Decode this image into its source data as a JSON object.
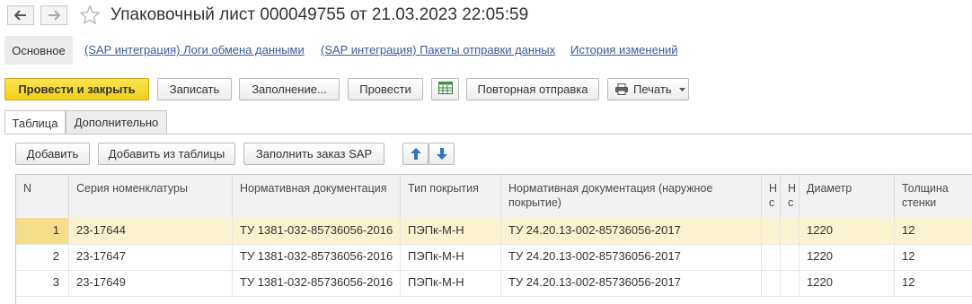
{
  "window": {
    "title": "Упаковочный лист 000049755 от 21.03.2023 22:05:59",
    "icons": [
      "arrow-left-icon",
      "arrow-right-icon",
      "star-icon"
    ]
  },
  "sections": {
    "main": "Основное",
    "links": [
      "(SAP интеграция) Логи обмена данными",
      "(SAP интеграция) Пакеты отправки данных",
      "История изменений"
    ]
  },
  "toolbar": {
    "post_and_close": "Провести и закрыть",
    "save": "Записать",
    "fill": "Заполнение...",
    "post": "Провести",
    "resend": "Повторная отправка",
    "print": "Печать",
    "icons": [
      "spreadsheet-icon",
      "printer-icon",
      "dropdown-caret-icon"
    ]
  },
  "tabs": {
    "table": "Таблица",
    "additional": "Дополнительно"
  },
  "table_toolbar": {
    "add": "Добавить",
    "add_from_table": "Добавить из таблицы",
    "fill_sap_order": "Заполнить заказ SAP",
    "icons": [
      "move-up-icon",
      "move-down-icon"
    ]
  },
  "table": {
    "columns": [
      {
        "key": "n",
        "label": "N"
      },
      {
        "key": "series",
        "label": "Серия номенклатуры"
      },
      {
        "key": "norm_doc",
        "label": "Нормативная документация"
      },
      {
        "key": "coating",
        "label": "Тип покрытия"
      },
      {
        "key": "norm_doc_outer",
        "label": "Нормативная документация (наружное покрытие)"
      },
      {
        "key": "h1",
        "label": "Н с"
      },
      {
        "key": "h2",
        "label": "Н с"
      },
      {
        "key": "diameter",
        "label": "Диаметр"
      },
      {
        "key": "wall",
        "label": "Толщина стенки"
      }
    ],
    "rows": [
      {
        "n": "1",
        "series": "23-17644",
        "norm_doc": "ТУ 1381-032-85736056-2016",
        "coating": "ПЭПк-М-Н",
        "norm_doc_outer": "ТУ 24.20.13-002-85736056-2017",
        "h1": "",
        "h2": "",
        "diameter": "1220",
        "wall": "12"
      },
      {
        "n": "2",
        "series": "23-17647",
        "norm_doc": "ТУ 1381-032-85736056-2016",
        "coating": "ПЭПк-М-Н",
        "norm_doc_outer": "ТУ 24.20.13-002-85736056-2017",
        "h1": "",
        "h2": "",
        "diameter": "1220",
        "wall": "12"
      },
      {
        "n": "3",
        "series": "23-17649",
        "norm_doc": "ТУ 1381-032-85736056-2016",
        "coating": "ПЭПк-М-Н",
        "norm_doc_outer": "ТУ 24.20.13-002-85736056-2017",
        "h1": "",
        "h2": "",
        "diameter": "1220",
        "wall": "12"
      }
    ],
    "selected_row": 0
  },
  "colors": {
    "primary_button": "#f2cf1d",
    "link": "#3b5b9b",
    "selected_row": "#fbf2cf",
    "focused_cell": "#f6dd8b"
  }
}
